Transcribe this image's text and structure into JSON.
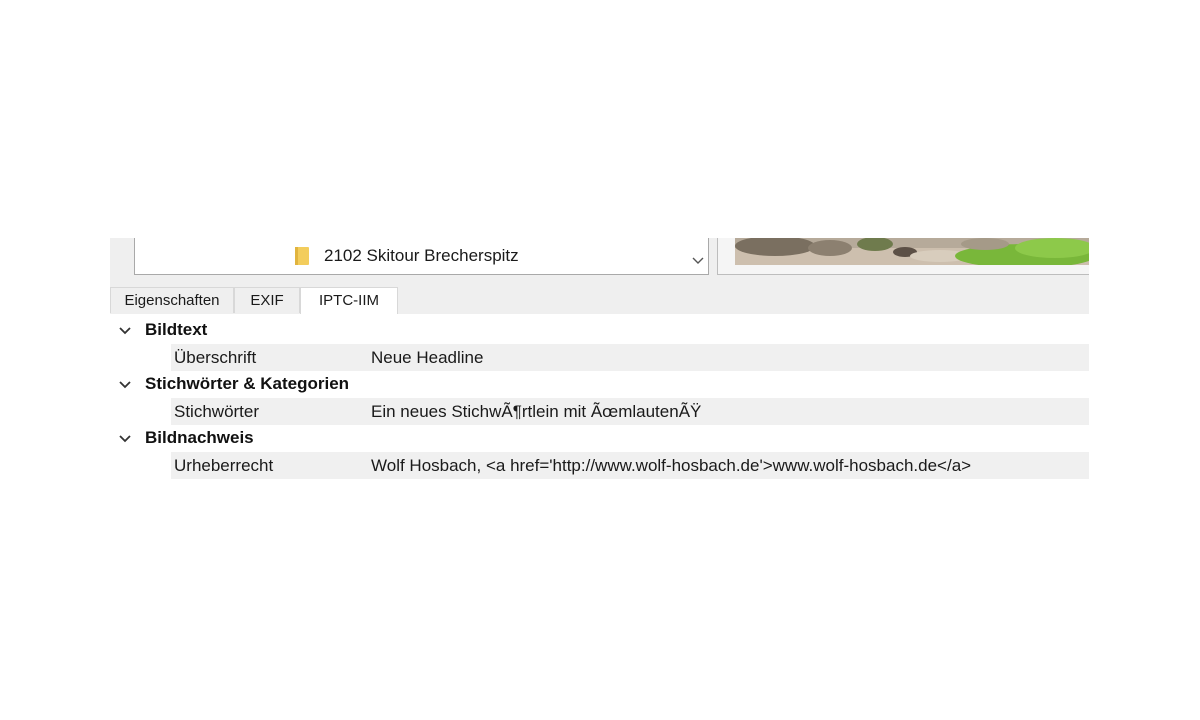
{
  "folder": {
    "name": "2102 Skitour Brecherspitz"
  },
  "tabs": [
    {
      "label": "Eigenschaften",
      "active": false
    },
    {
      "label": "EXIF",
      "active": false
    },
    {
      "label": "IPTC-IIM",
      "active": true
    }
  ],
  "groups": [
    {
      "title": "Bildtext",
      "expanded": true,
      "properties": [
        {
          "name": "Überschrift",
          "value": "Neue Headline"
        }
      ]
    },
    {
      "title": "Stichwörter & Kategorien",
      "expanded": true,
      "properties": [
        {
          "name": "Stichwörter",
          "value": "Ein neues StichwÃ¶rtlein mit ÃœmlautenÃŸ"
        }
      ]
    },
    {
      "title": "Bildnachweis",
      "expanded": true,
      "properties": [
        {
          "name": "Urheberrecht",
          "value": "Wolf Hosbach, <a href='http://www.wolf-hosbach.de'>www.wolf-hosbach.de</a>"
        }
      ]
    }
  ],
  "icons": {
    "folder": "folder-icon",
    "scroll": "chevron-down-icon",
    "group_toggle": "chevron-down-icon"
  },
  "colors": {
    "folder_icon": "#f3cd5c",
    "row_stripe": "#f0f0f0",
    "panel_bg": "#efefef"
  }
}
